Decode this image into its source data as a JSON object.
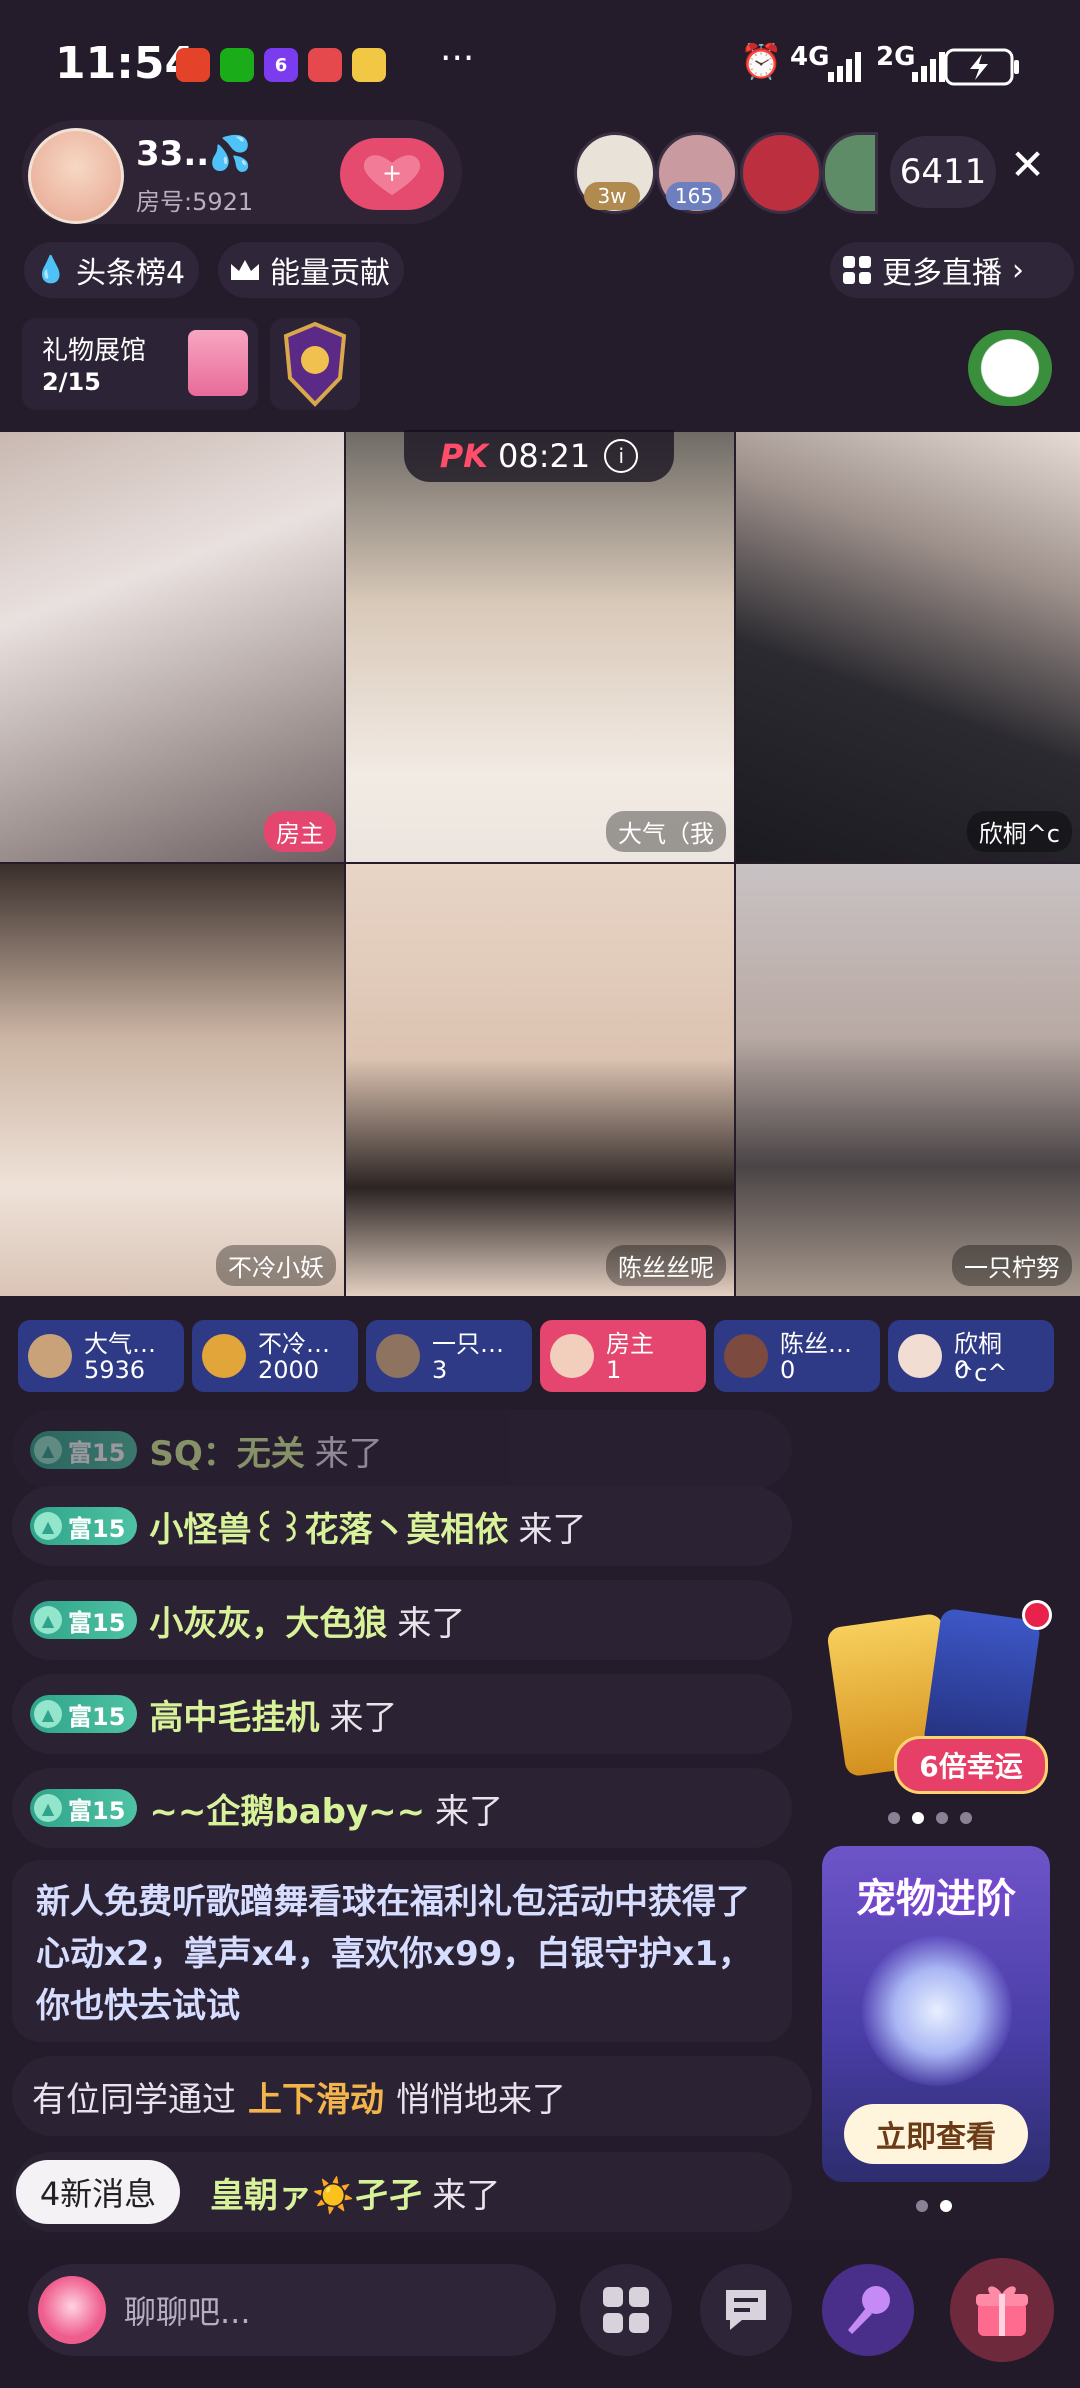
{
  "status_bar": {
    "time": "11:54",
    "app_icons": [
      {
        "name": "huawei-icon",
        "color": "#e4432a",
        "text": ""
      },
      {
        "name": "wechat-icon",
        "color": "#1aad19",
        "text": ""
      },
      {
        "name": "app-6-icon",
        "color": "#7b3cf0",
        "text": "6"
      },
      {
        "name": "red-app-icon",
        "color": "#e5484d",
        "text": ""
      },
      {
        "name": "yellow-app-icon",
        "color": "#f2c744",
        "text": ""
      }
    ],
    "more": "···",
    "net1": "4G",
    "net2": "2G"
  },
  "header": {
    "host_name": "33..💦",
    "room_no": "房号:5921",
    "follow_symbol": "+",
    "viewers": [
      {
        "badge": "3w",
        "color": "#b08a4e",
        "avatar": "#e8e2d8"
      },
      {
        "badge": "165",
        "color": "#6d7fbf",
        "avatar": "#c99aa0"
      },
      {
        "badge": "",
        "color": "",
        "avatar": "#bb2f3f"
      },
      {
        "badge": "",
        "color": "",
        "avatar": "#5d8c67"
      }
    ],
    "viewer_count": "6411",
    "close_symbol": "✕"
  },
  "chips": {
    "headline": "头条榜4",
    "energy": "能量贡献",
    "more_live": "更多直播"
  },
  "gift_hall": {
    "title": "礼物展馆",
    "progress": "2/15"
  },
  "pk": {
    "label": "PK",
    "timer": "08:21",
    "info": "i"
  },
  "streams": [
    {
      "label": "房主",
      "highlight": true,
      "bg": "linear-gradient(160deg,#c9b8b1 0%,#e9e1df 35%,#a89c9a 70%,#6c5f62 100%)"
    },
    {
      "label": "大气（我",
      "highlight": false,
      "bg": "linear-gradient(180deg,#6f6b66 0%,#d9c9b9 40%,#f2ebe4 80%,#ece5df 100%)"
    },
    {
      "label": "欣桐^c",
      "highlight": false,
      "bg": "linear-gradient(200deg,#e8ddd6 0%,#9c8f8a 30%,#2b2a30 60%,#1b1a20 100%)"
    },
    {
      "label": "不冷小妖",
      "highlight": false,
      "bg": "linear-gradient(180deg,#3a2f2c 0%,#cbb4a3 40%,#efe2d8 75%,#d9c4b6 100%)"
    },
    {
      "label": "陈丝丝呢",
      "highlight": false,
      "bg": "linear-gradient(180deg,#e8d5c6 0%,#dcc3b1 45%,#2b2423 75%,#e4d0c2 100%)"
    },
    {
      "label": "一只柠努",
      "highlight": false,
      "bg": "linear-gradient(180deg,#c9c2c4 0%,#b8a9a3 40%,#4a4446 70%,#a89a8e 100%)"
    }
  ],
  "scores": [
    {
      "name": "大气…",
      "value": "5936",
      "bg": "#2f3a86",
      "av": "#c9a27a"
    },
    {
      "name": "不冷…",
      "value": "2000",
      "bg": "#2f3a86",
      "av": "#e2a53a"
    },
    {
      "name": "一只…",
      "value": "3",
      "bg": "#2f3a86",
      "av": "#8d7360"
    },
    {
      "name": "房主",
      "value": "1",
      "bg": "#e5466f",
      "av": "#f2cfbc"
    },
    {
      "name": "陈丝…",
      "value": "0",
      "bg": "#2f3a86",
      "av": "#7c4a3f"
    },
    {
      "name": "欣桐^c^",
      "value": "0",
      "bg": "#2f3a86",
      "av": "#f1ddd2"
    }
  ],
  "chat": [
    {
      "level": "富15",
      "user": "SQ：无关",
      "action": "来了",
      "faded": true
    },
    {
      "level": "富15",
      "user": "小怪兽꒰꒱花落丶莫相依",
      "action": "来了",
      "faded": false
    },
    {
      "level": "富15",
      "user": "小灰灰，大色狼",
      "action": "来了",
      "faded": false
    },
    {
      "level": "富15",
      "user": "高中毛挂机",
      "action": "来了",
      "faded": false
    },
    {
      "level": "富15",
      "user": "~~企鹅baby~~",
      "action": "来了",
      "faded": false
    }
  ],
  "system_msg": "新人免费听歌蹭舞看球在福利礼包活动中获得了心动x2，掌声x4，喜欢你x99，白银守护x1，你也快去试试",
  "hint": {
    "pre": "有位同学通过",
    "highlight": "上下滑动",
    "post": "悄悄地来了"
  },
  "last_msg": {
    "user": "皇朝ァ☀️孑孑",
    "action": "来了"
  },
  "new_messages": "4新消息",
  "luck": {
    "button": "6倍幸运"
  },
  "pet": {
    "title": "宠物进阶",
    "button": "立即查看"
  },
  "input": {
    "placeholder": "聊聊吧..."
  }
}
